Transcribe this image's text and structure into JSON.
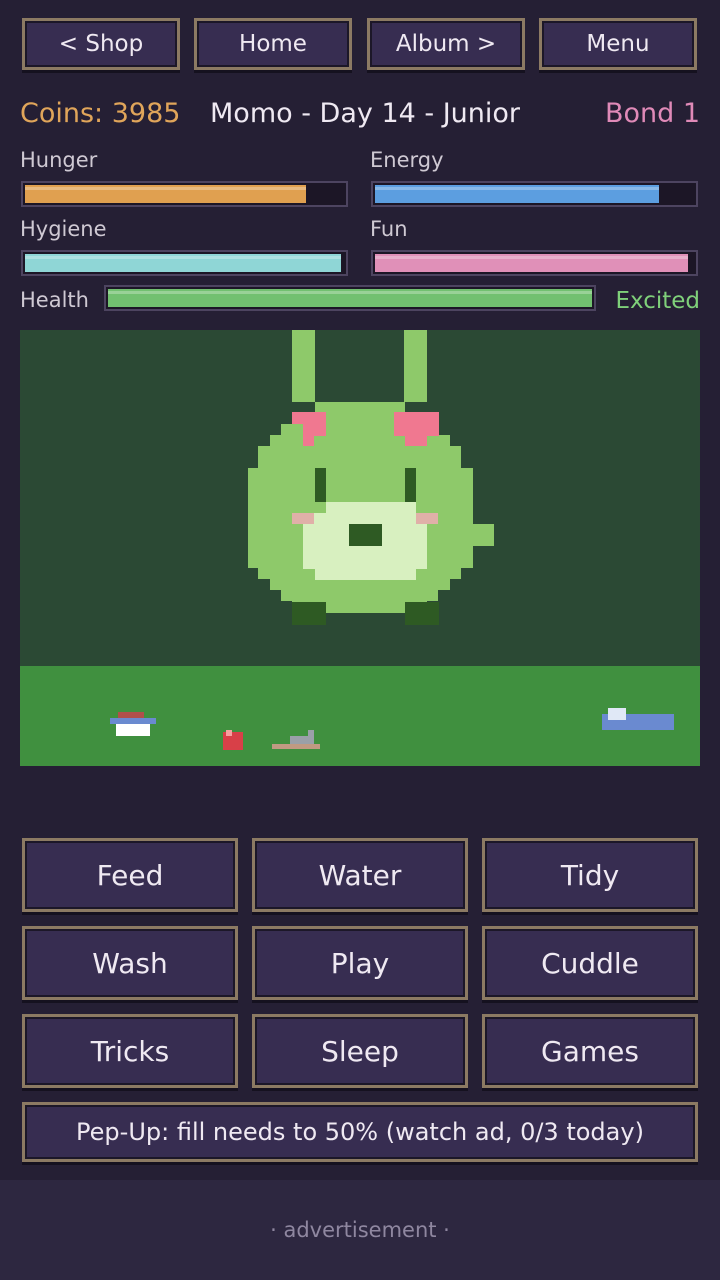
{
  "nav": {
    "shop": "< Shop",
    "home": "Home",
    "album": "Album >",
    "menu": "Menu"
  },
  "header": {
    "coins": "Coins: 3985",
    "pet_title": "Momo - Day 14 - Junior",
    "bond": "Bond 1"
  },
  "stats": {
    "hunger": {
      "label": "Hunger",
      "level": 0.88,
      "color": "#e0a050"
    },
    "energy": {
      "label": "Energy",
      "level": 0.89,
      "color": "#5c9ee0"
    },
    "hygiene": {
      "label": "Hygiene",
      "level": 0.99,
      "color": "#8fd6d6"
    },
    "fun": {
      "label": "Fun",
      "level": 0.98,
      "color": "#e090b8"
    },
    "health": {
      "label": "Health",
      "level": 1.0,
      "color": "#72c070"
    }
  },
  "mood": "Excited",
  "colors": {
    "coins": "#e0a55a",
    "bond": "#e08ab8",
    "mood": "#7fd07a",
    "sky": "#2b4934",
    "ground": "#40903f",
    "pet_body": "#8ec96a",
    "pet_belly": "#d8f0c0",
    "pet_dark": "#2e5a23",
    "pet_bow": "#f07890"
  },
  "scene_items": [
    "food-bowl-icon",
    "apple-icon",
    "toy-mouse-icon",
    "pet-bed-icon"
  ],
  "actions": [
    "Feed",
    "Water",
    "Tidy",
    "Wash",
    "Play",
    "Cuddle",
    "Tricks",
    "Sleep",
    "Games"
  ],
  "pepup": "Pep-Up: fill needs to 50%  (watch ad, 0/3 today)",
  "ad_label": "· advertisement ·"
}
